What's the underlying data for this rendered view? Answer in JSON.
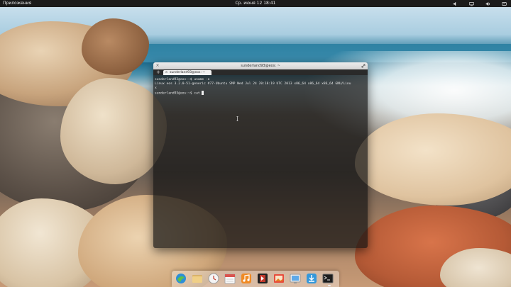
{
  "top_panel": {
    "apps_label": "Приложения",
    "clock": "Ср. июня 12 18:41",
    "tray_icons": [
      "speaker-icon",
      "network-icon",
      "sound-icon",
      "power-icon"
    ]
  },
  "terminal": {
    "window_title": "sunderland93@eos: ~",
    "tab_label": "sunderland93@eos: ~",
    "lines": [
      "sunderland93@eos:~$ uname -a",
      "Linux eos 3.2.0-51-generic #77-Ubuntu SMP Wed Jul 24 20:18:19 UTC 2013 x86_64 x86_64 x86_64 GNU/Linu",
      "x",
      "sunderland93@eos:~$ cat "
    ]
  },
  "dock": {
    "items": [
      "midori-icon",
      "files-icon",
      "clock-icon",
      "calendar-icon",
      "music-icon",
      "video-icon",
      "photos-icon",
      "system-settings-icon",
      "software-center-icon",
      "terminal-icon"
    ]
  },
  "colors": {
    "panel_bg": "#1b1b1b",
    "terminal_bg": "#121212"
  }
}
